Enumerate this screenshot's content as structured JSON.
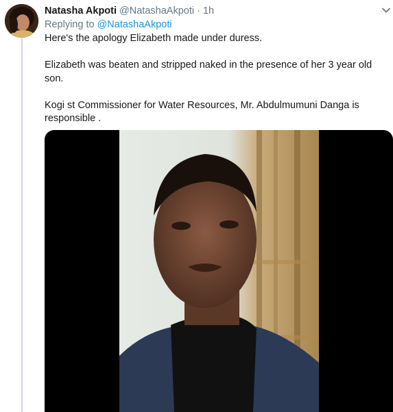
{
  "tweet": {
    "display_name": "Natasha Akpoti",
    "handle": "@NatashaAkpoti",
    "separator": "·",
    "time": "1h",
    "replying_prefix": "Replying to",
    "replying_to": "@NatashaAkpoti",
    "paragraphs": [
      "Here's the apology Elizabeth made under duress.",
      "Elizabeth was beaten and stripped naked in the presence of her 3 year old son.",
      "Kogi st Commissioner for Water Resources, Mr. Abdulmumuni Danga is responsible ."
    ]
  },
  "icons": {
    "avatar": "profile-photo",
    "caret": "chevron-down-icon",
    "video": "video-frame"
  },
  "colors": {
    "link": "#1b95e0",
    "secondary_text": "#657786",
    "thread_line": "#ccd6dd"
  }
}
